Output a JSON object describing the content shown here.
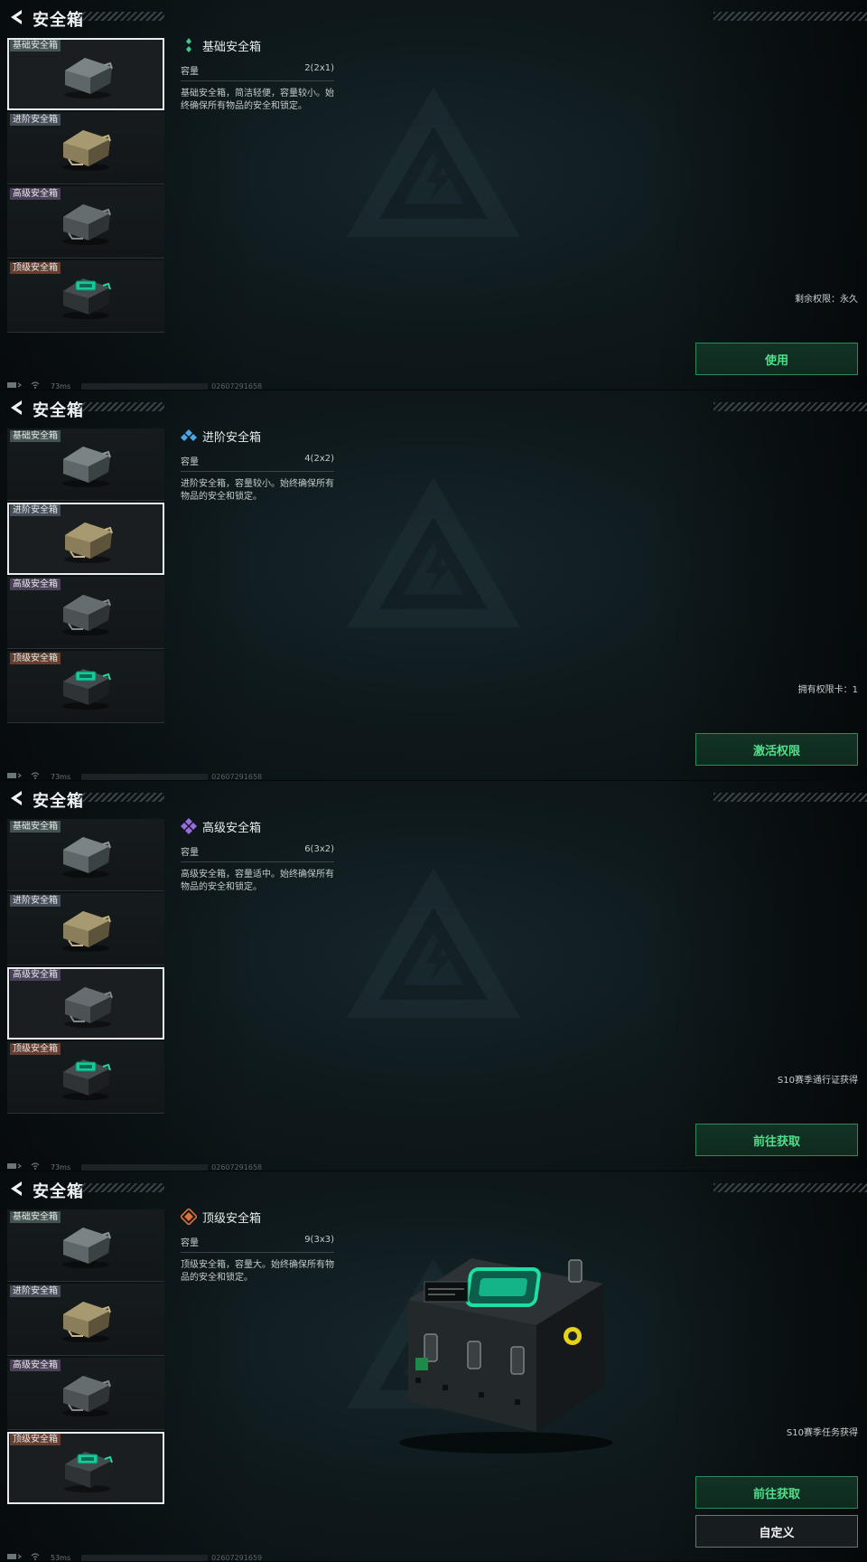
{
  "colors": {
    "accent_green": "#4fe08a",
    "rarity_basic": "#3fc98c",
    "rarity_advanced": "#4aa6e8",
    "rarity_high": "#9b6be0",
    "rarity_top": "#e0703a"
  },
  "panels": [
    {
      "title": "安全箱",
      "items": [
        {
          "tag": "基础安全箱",
          "selected": true
        },
        {
          "tag": "进阶安全箱",
          "selected": false
        },
        {
          "tag": "高级安全箱",
          "selected": false
        },
        {
          "tag": "顶级安全箱",
          "selected": false
        }
      ],
      "detail": {
        "icon": "rarity-basic-icon",
        "name": "基础安全箱",
        "capacity_label": "容量",
        "capacity_value": "2(2x1)",
        "description": "基础安全箱，简洁轻便，容量较小。始终确保所有物品的安全和锁定。"
      },
      "status_text": "剩余权限：永久",
      "buttons": [
        {
          "label": "使用"
        }
      ],
      "footer": {
        "ping": "73ms",
        "uid": "02607291658"
      }
    },
    {
      "title": "安全箱",
      "items": [
        {
          "tag": "基础安全箱",
          "selected": false
        },
        {
          "tag": "进阶安全箱",
          "selected": true
        },
        {
          "tag": "高级安全箱",
          "selected": false
        },
        {
          "tag": "顶级安全箱",
          "selected": false
        }
      ],
      "detail": {
        "icon": "rarity-advanced-icon",
        "name": "进阶安全箱",
        "capacity_label": "容量",
        "capacity_value": "4(2x2)",
        "description": "进阶安全箱，容量较小。始终确保所有物品的安全和锁定。"
      },
      "status_text": "拥有权限卡：1",
      "buttons": [
        {
          "label": "激活权限"
        }
      ],
      "footer": {
        "ping": "73ms",
        "uid": "02607291658"
      }
    },
    {
      "title": "安全箱",
      "items": [
        {
          "tag": "基础安全箱",
          "selected": false
        },
        {
          "tag": "进阶安全箱",
          "selected": false
        },
        {
          "tag": "高级安全箱",
          "selected": true
        },
        {
          "tag": "顶级安全箱",
          "selected": false
        }
      ],
      "detail": {
        "icon": "rarity-high-icon",
        "name": "高级安全箱",
        "capacity_label": "容量",
        "capacity_value": "6(3x2)",
        "description": "高级安全箱，容量适中。始终确保所有物品的安全和锁定。"
      },
      "status_text": "S10赛季通行证获得",
      "buttons": [
        {
          "label": "前往获取"
        }
      ],
      "footer": {
        "ping": "73ms",
        "uid": "02607291658"
      }
    },
    {
      "title": "安全箱",
      "items": [
        {
          "tag": "基础安全箱",
          "selected": false
        },
        {
          "tag": "进阶安全箱",
          "selected": false
        },
        {
          "tag": "高级安全箱",
          "selected": false
        },
        {
          "tag": "顶级安全箱",
          "selected": true
        }
      ],
      "detail": {
        "icon": "rarity-top-icon",
        "name": "顶级安全箱",
        "capacity_label": "容量",
        "capacity_value": "9(3x3)",
        "description": "顶级安全箱，容量大。始终确保所有物品的安全和锁定。"
      },
      "status_text": "S10赛季任务获得",
      "buttons": [
        {
          "label": "前往获取"
        },
        {
          "label": "自定义"
        }
      ],
      "footer": {
        "ping": "53ms",
        "uid": "02607291659"
      }
    }
  ]
}
